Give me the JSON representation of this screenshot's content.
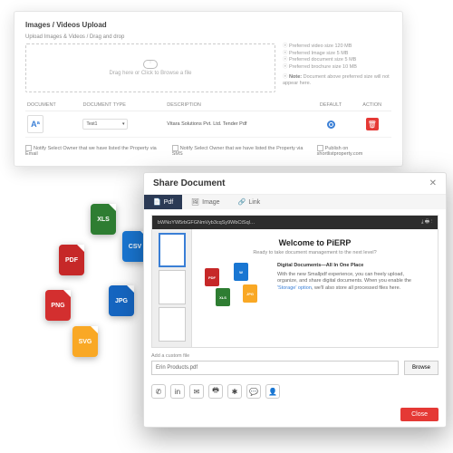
{
  "panel1": {
    "title": "Images / Videos Upload",
    "subtitle": "Upload Images & Videos / Drag and drop",
    "dropzone": "Drag here or Click to Browse a file",
    "requirements": [
      "Preferred video size 120 MB",
      "Preferred Image size 5 MB",
      "Preferred document size 5 MB",
      "Preferred brochure size 10 MB"
    ],
    "note_label": "Note:",
    "note": "Document above preferred size will not appear here.",
    "headers": {
      "doc": "DOCUMENT",
      "type": "DOCUMENT TYPE",
      "desc": "DESCRIPTION",
      "def": "DEFAULT",
      "act": "ACTION"
    },
    "row": {
      "icon": "Aª",
      "type": "Test1",
      "desc": "Vitara Solutions Pvt. Ltd. Tender Pdf"
    },
    "checks": {
      "email": "Notify Select Owner that we have listed the Property via Email",
      "sms": "Notify Select Owner that we have listed the Property via SMS",
      "publish": "Publish on shortlistproperty.com"
    }
  },
  "fileicons": {
    "xls": "XLS",
    "csv": "CSV",
    "pdf": "PDF",
    "png": "PNG",
    "jpg": "JPG",
    "svg": "SVG"
  },
  "panel2": {
    "title": "Share Document",
    "tabs": {
      "pdf": "Pdf",
      "image": "Image",
      "link": "Link"
    },
    "url": "bWNoYW5rbGFGNmVyb3cqSy9WbCtSql…",
    "welcome": "Welcome to PiERP",
    "welcome_sub": "Ready to take document management to the next level?",
    "block_title": "Digital Documents—All In One Place",
    "block_text_a": "With the new Smallpdf experience, you can freely upload, organize, and share digital documents. When you enable the ",
    "block_link": "'Storage' option",
    "block_text_b": ", we'll also store all processed files here.",
    "file_label": "Add a custom file",
    "file_value": "Erin Products.pdf",
    "browse": "Browse",
    "close": "Close",
    "share_icons": [
      "whatsapp",
      "linkedin",
      "mail",
      "print",
      "slack",
      "comment",
      "user"
    ]
  }
}
